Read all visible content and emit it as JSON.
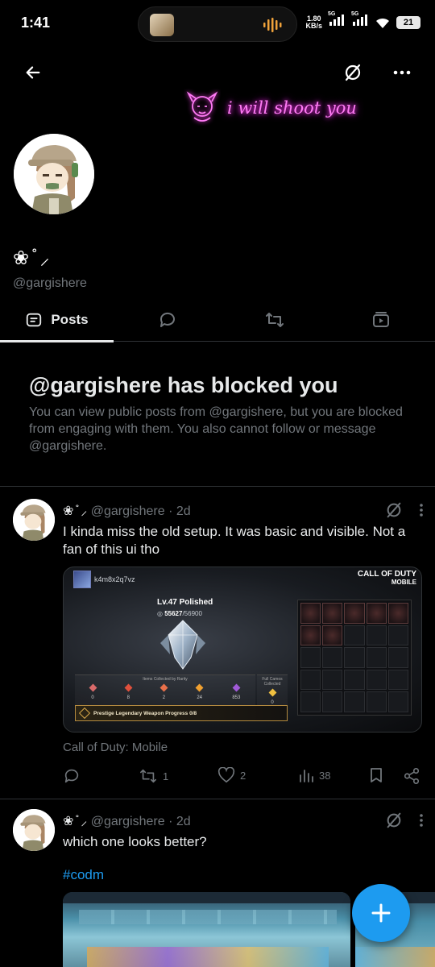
{
  "status_bar": {
    "time": "1:41",
    "net_speed": "1.80",
    "net_unit": "KB/s",
    "sim1": "5G",
    "sim2": "5G",
    "battery": "21"
  },
  "profile": {
    "banner_text": "i will shoot you",
    "display_name": "❀ ̊ ⸝",
    "handle": "@gargishere"
  },
  "tabs": [
    {
      "label": "Posts",
      "icon": "posts-icon",
      "active": true
    },
    {
      "label": "",
      "icon": "replies-icon",
      "active": false
    },
    {
      "label": "",
      "icon": "reposts-icon",
      "active": false
    },
    {
      "label": "",
      "icon": "media-icon",
      "active": false
    }
  ],
  "blocked_notice": {
    "title": "@gargishere has blocked you",
    "body": "You can view public posts from @gargishere, but you are blocked from engaging with them. You also cannot follow or message @gargishere."
  },
  "posts": [
    {
      "name": "❀ ̊ ⸝",
      "handle": "@gargishere",
      "time": "· 2d",
      "text": "I kinda miss the old setup. It was basic and visible. Not a fan of this ui tho",
      "media": {
        "username": "k4m8x2q7vz",
        "logo_line1": "CALL OF DUTY",
        "logo_line2": "MOBILE",
        "level": "Lv.47 Polished",
        "xp_current": "55627",
        "xp_total": "/56900",
        "rarity_header": "Items Collected by Rarity",
        "collection_header": "Full Camos Collected",
        "rarity_counts": [
          "0",
          "8",
          "2",
          "24",
          "853"
        ],
        "collection_count": "0",
        "progress_text": "Prestige Legendary Weapon Progress 0/8"
      },
      "caption": "Call of Duty: Mobile",
      "stats": {
        "replies": "",
        "reposts": "1",
        "likes": "2",
        "views": "38"
      }
    },
    {
      "name": "❀ ̊ ⸝",
      "handle": "@gargishere",
      "time": "· 2d",
      "text": "which one looks better?",
      "hashtag": "#codm"
    }
  ],
  "colors": {
    "background": "#000000",
    "text_primary": "#e7e9ea",
    "text_secondary": "#71767b",
    "accent": "#1d9bf0",
    "neon": "#ff7bf5",
    "divider": "#2f3336"
  }
}
